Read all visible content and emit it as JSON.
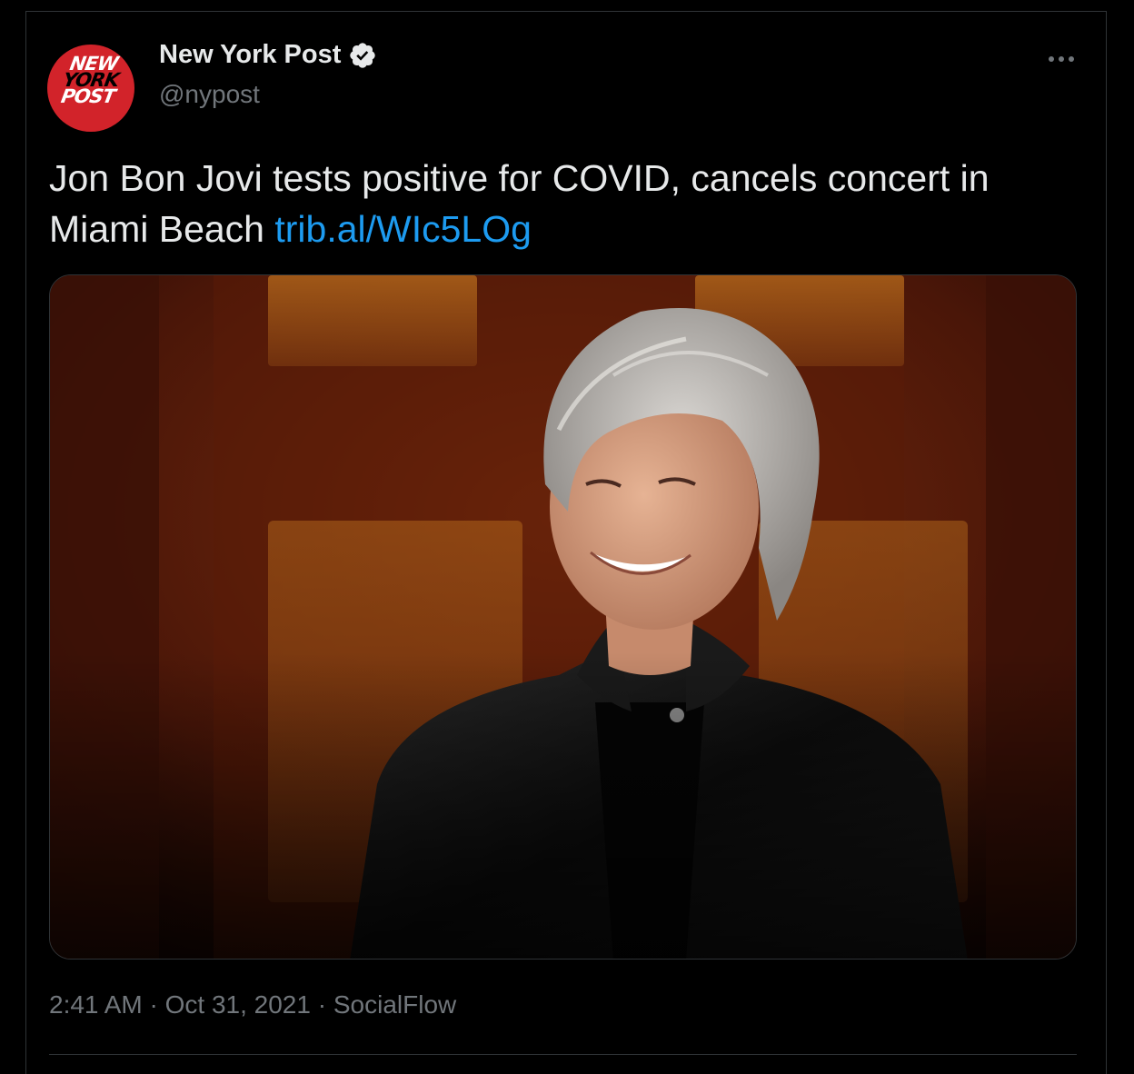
{
  "author": {
    "display_name": "New York Post",
    "handle": "@nypost",
    "avatar_lines": [
      "NEW",
      "YORK",
      "POST"
    ],
    "verified": true
  },
  "tweet": {
    "text": "Jon Bon Jovi tests positive for COVID, cancels concert in Miami Beach ",
    "link": "trib.al/WIc5LOg"
  },
  "meta": {
    "time": "2:41 AM",
    "separator1": " · ",
    "date": "Oct 31, 2021",
    "separator2": " · ",
    "source": "SocialFlow"
  },
  "icons": {
    "more": "more-horizontal-icon",
    "verified": "verified-badge-icon"
  },
  "colors": {
    "background": "#000000",
    "text": "#e7e9ea",
    "secondary": "#71767b",
    "link": "#1d9bf0",
    "brand_red": "#d2232a"
  }
}
